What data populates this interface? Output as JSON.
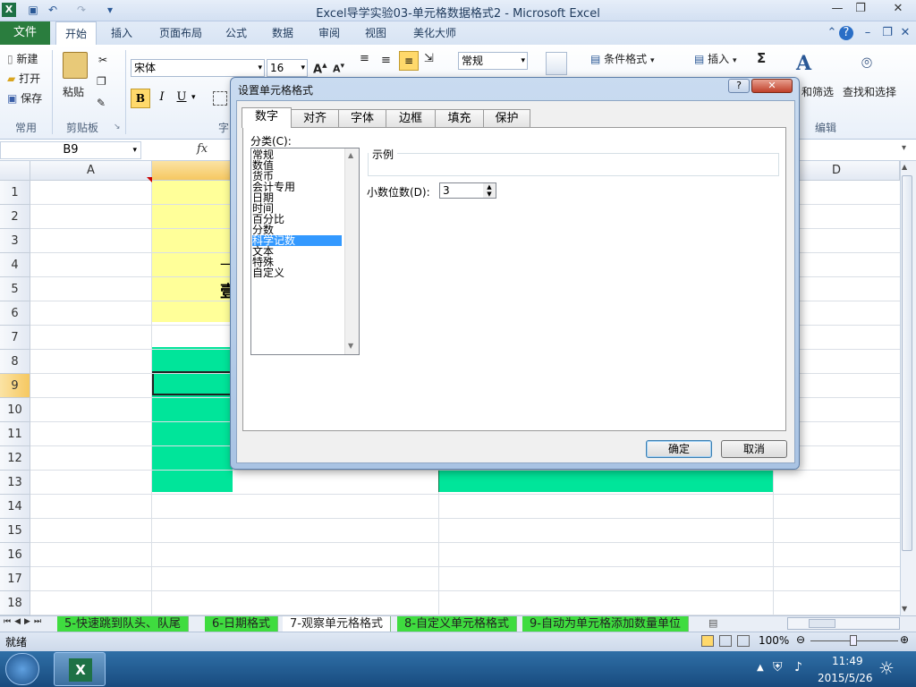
{
  "window": {
    "title": "Excel导学实验03-单元格数据格式2 - Microsoft Excel",
    "logo_letter": "X"
  },
  "ribbon_tabs": [
    "文件",
    "开始",
    "插入",
    "页面布局",
    "公式",
    "数据",
    "审阅",
    "视图",
    "美化大师"
  ],
  "ribbon": {
    "changyong": {
      "new": "新建",
      "open": "打开",
      "save": "保存",
      "label": "常用"
    },
    "clipboard": {
      "paste": "粘贴",
      "label": "剪贴板"
    },
    "font": {
      "name": "宋体",
      "size": "16",
      "bold": "B",
      "italic": "I",
      "underline": "U",
      "label": "字"
    },
    "number": {
      "format": "常规"
    },
    "styles": {
      "cond_format": "条件格式"
    },
    "cells": {
      "insert": "插入"
    },
    "editing": {
      "sigma": "Σ",
      "filter": "和筛选",
      "find": "查找和选择",
      "label": "编辑"
    }
  },
  "formula_bar": {
    "name_box": "B9",
    "fx": "fx"
  },
  "columns": [
    "A",
    "D"
  ],
  "rows": [
    "1",
    "2",
    "3",
    "4",
    "5",
    "6",
    "7",
    "8",
    "9",
    "10",
    "11",
    "12",
    "13",
    "14",
    "15",
    "16",
    "17",
    "18"
  ],
  "cells": {
    "b4_fragment": "一",
    "b5_fragment": "壹"
  },
  "sheet_tabs": [
    "5-快速跳到队头、队尾",
    "6-日期格式",
    "7-观察单元格格式",
    "8-自定义单元格格式",
    "9-自动为单元格添加数量单位"
  ],
  "status": {
    "ready": "就绪",
    "zoom": "100%"
  },
  "taskbar": {
    "time": "11:49",
    "date": "2015/5/26"
  },
  "dialog": {
    "title": "设置单元格格式",
    "help": "?",
    "tabs": [
      "数字",
      "对齐",
      "字体",
      "边框",
      "填充",
      "保护"
    ],
    "category_label": "分类(C):",
    "categories": [
      "常规",
      "数值",
      "货币",
      "会计专用",
      "日期",
      "时间",
      "百分比",
      "分数",
      "科学记数",
      "文本",
      "特殊",
      "自定义"
    ],
    "selected_index": 8,
    "sample_label": "示例",
    "decimals_label": "小数位数(D):",
    "decimals_value": "3",
    "ok": "确定",
    "cancel": "取消"
  },
  "colors": {
    "yellow_cell": "#ffff99",
    "green_cell": "#00e59a",
    "selection": "#3399ff",
    "sheet_tab_green": "#3fdc3f"
  }
}
